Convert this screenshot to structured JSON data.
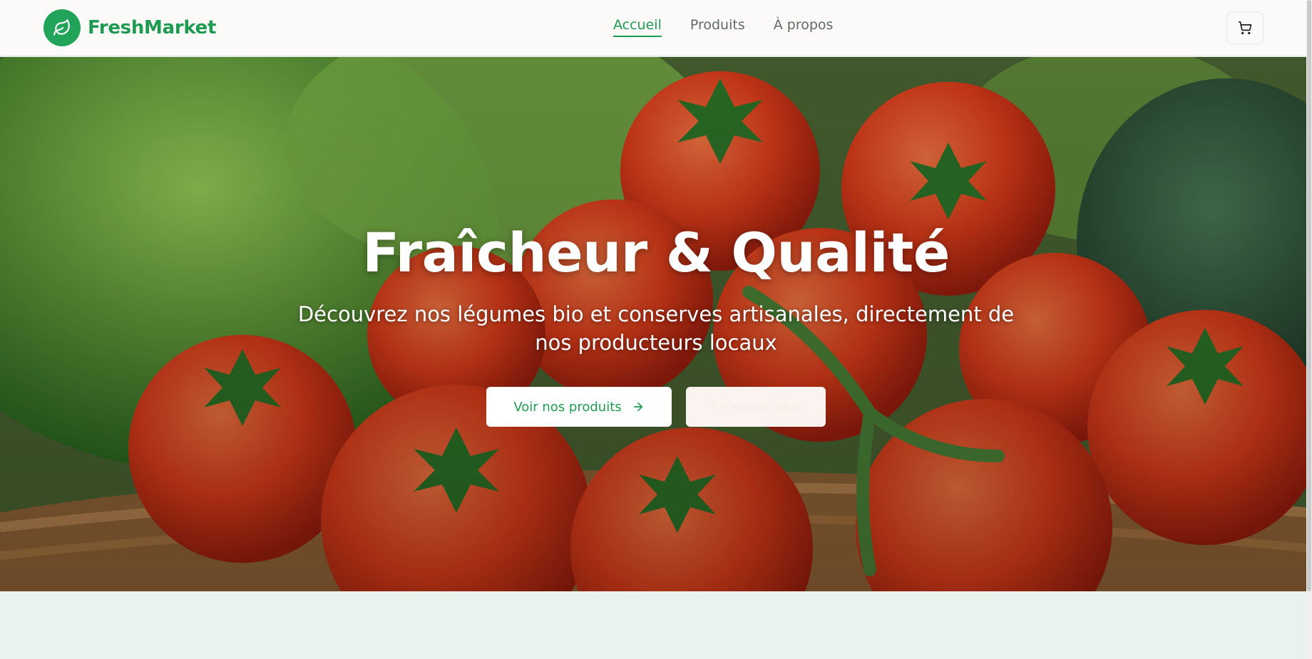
{
  "brand": {
    "name": "FreshMarket",
    "logo_icon": "leaf-icon",
    "accent": "#1f9a52"
  },
  "nav": {
    "items": [
      {
        "label": "Accueil",
        "active": true
      },
      {
        "label": "Produits",
        "active": false
      },
      {
        "label": "À propos",
        "active": false
      }
    ]
  },
  "cart": {
    "icon": "cart-icon"
  },
  "hero": {
    "title": "Fraîcheur & Qualité",
    "subtitle": "Découvrez nos légumes bio et conserves artisanales, directement de nos producteurs locaux",
    "primary_cta": {
      "label": "Voir nos produits",
      "icon": "arrow-right-icon"
    },
    "secondary_cta": {
      "label": "En savoir plus"
    }
  }
}
